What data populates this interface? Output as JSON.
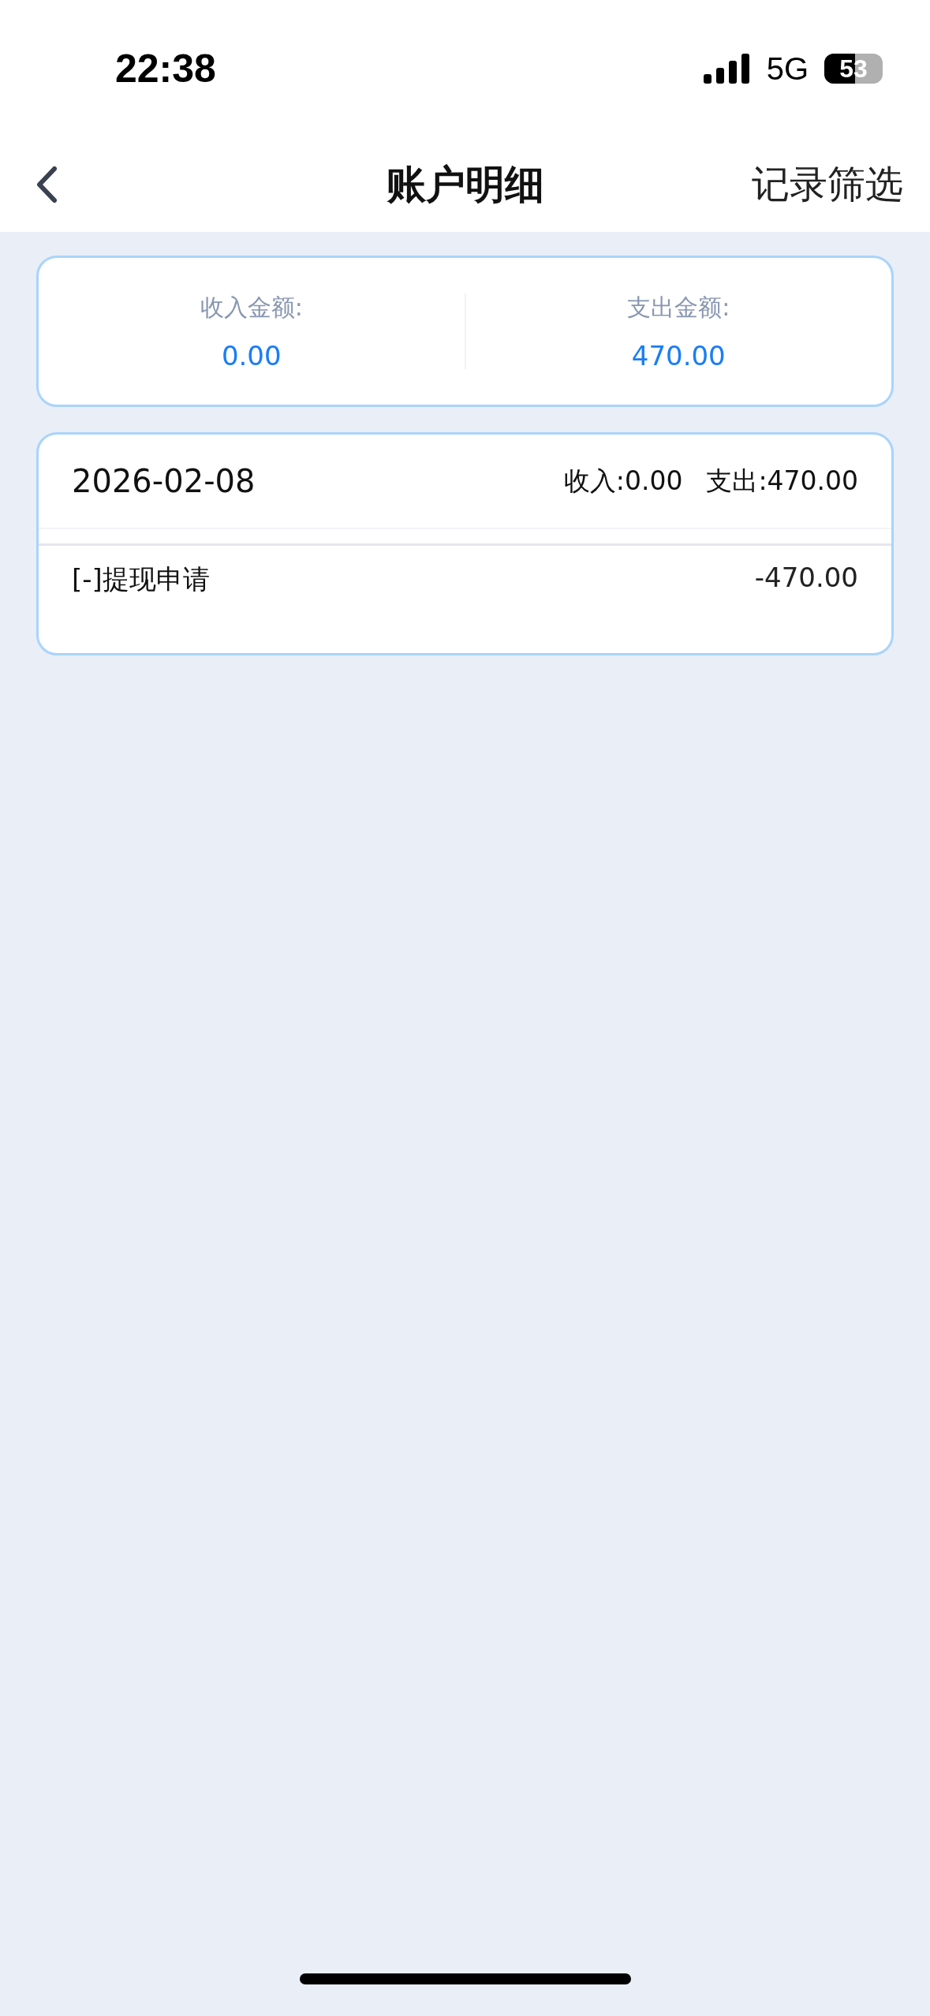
{
  "status_bar": {
    "time": "22:38",
    "network": "5G",
    "battery": "53"
  },
  "nav": {
    "title": "账户明细",
    "action": "记录筛选"
  },
  "summary": [
    {
      "label": "收入金额:",
      "value": "0.00"
    },
    {
      "label": "支出金额:",
      "value": "470.00"
    }
  ],
  "days": [
    {
      "date": "2026-02-08",
      "income": "收入:0.00",
      "expense": "支出:470.00",
      "records": [
        {
          "title": "[-]提现申请",
          "amount": "-470.00"
        }
      ]
    }
  ]
}
